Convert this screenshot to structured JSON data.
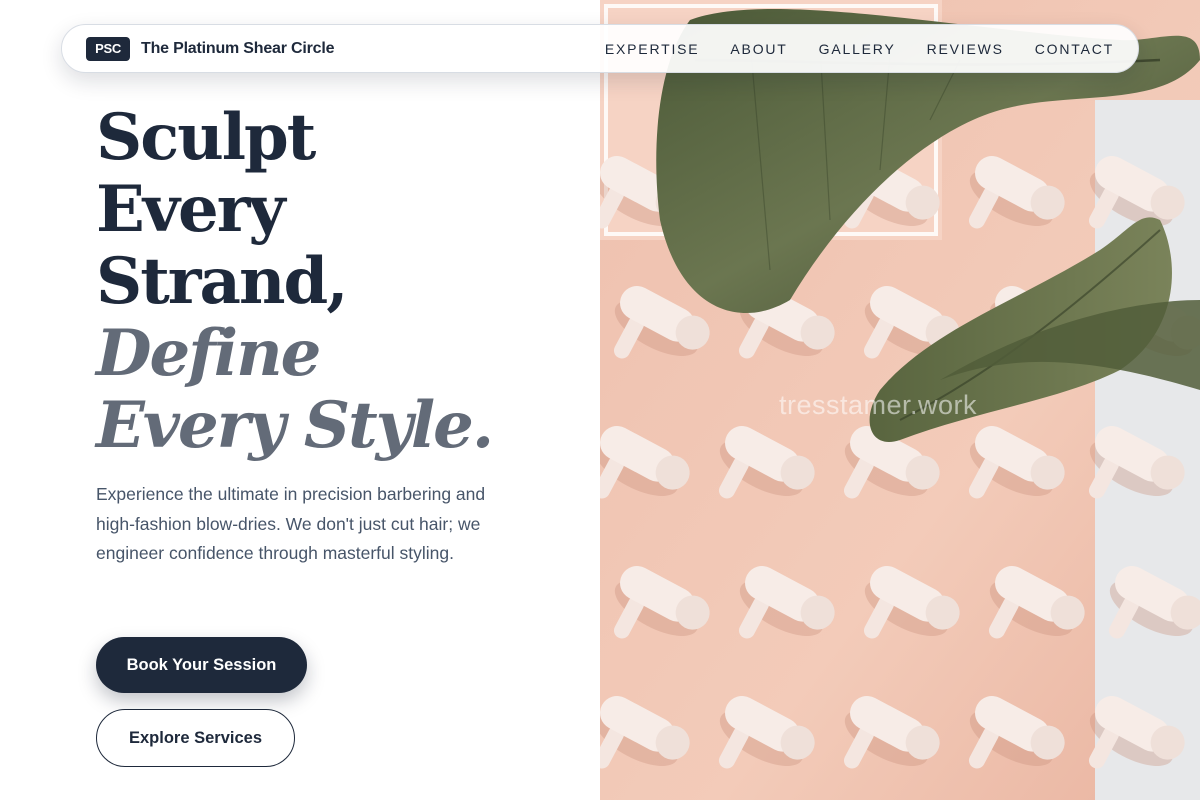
{
  "brand": {
    "badge": "PSC",
    "name": "The Platinum Shear Circle"
  },
  "nav": {
    "items": [
      {
        "label": "EXPERTISE"
      },
      {
        "label": "ABOUT"
      },
      {
        "label": "GALLERY"
      },
      {
        "label": "REVIEWS"
      },
      {
        "label": "CONTACT"
      }
    ]
  },
  "hero": {
    "headline": {
      "line1": "Sculpt",
      "line2": "Every",
      "line3": "Strand,",
      "accent1": "Define",
      "accent2": "Every Style."
    },
    "description": "Experience the ultimate in precision barbering and high-fashion blow-dries. We don't just cut hair; we engineer confidence through masterful styling.",
    "primary_button": "Book Your Session",
    "secondary_button": "Explore Services"
  },
  "image": {
    "watermark": "tresstamer.work",
    "subject": "pink wall lined with white hair dryers behind tropical leaves"
  },
  "colors": {
    "primary": "#1e293b",
    "accent_text": "#636b78",
    "body_text": "#475569",
    "wall_pink": "#f0c4b2",
    "leaf_green": "#5a6644"
  }
}
